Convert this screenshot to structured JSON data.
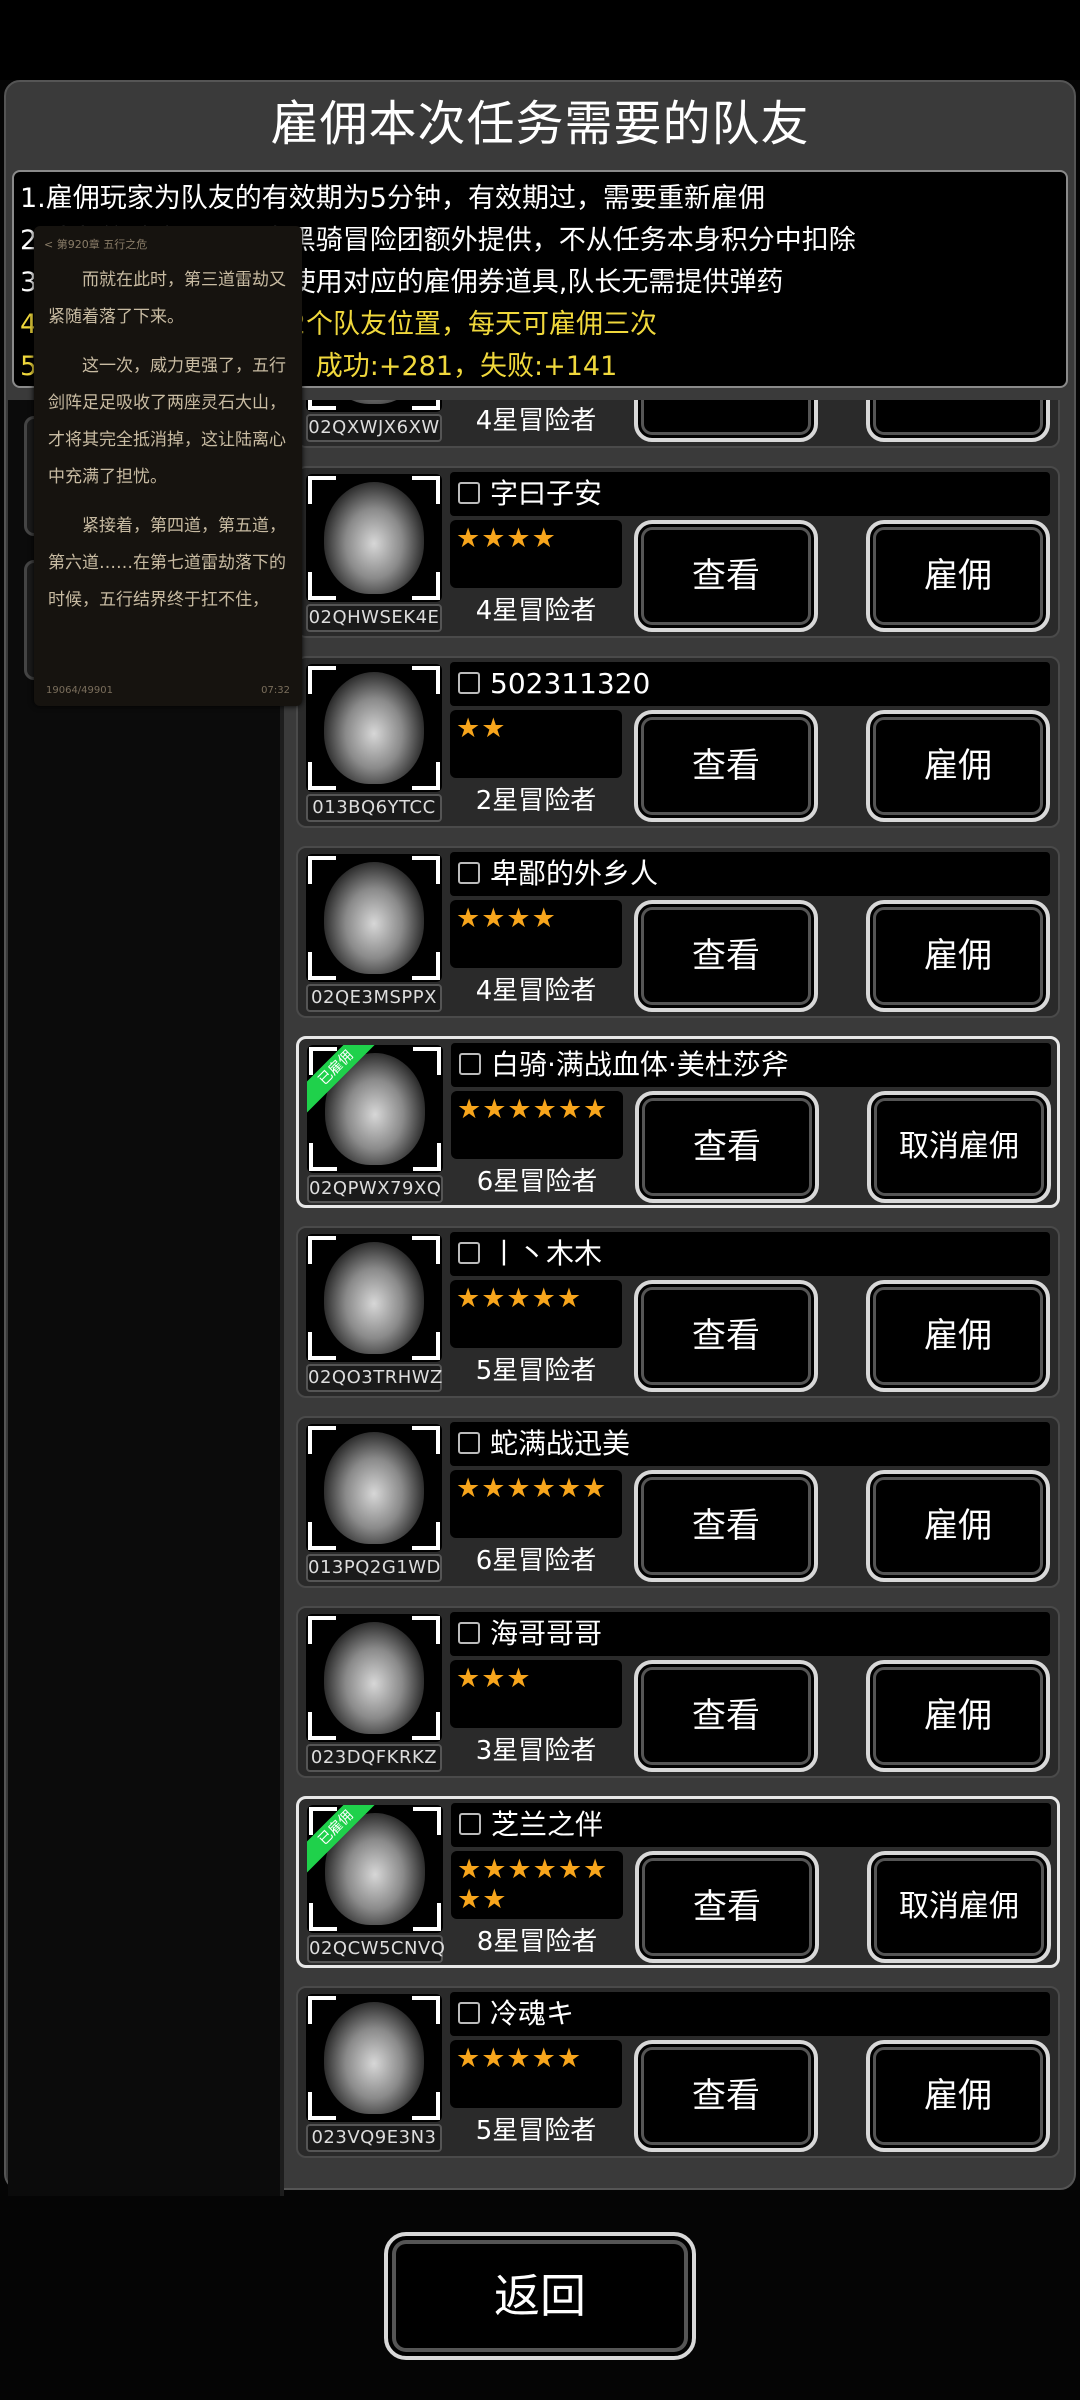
{
  "title": "雇佣本次任务需要的队友",
  "rules": [
    "1.雇佣玩家为队友的有效期为5分钟，有效期过，需要重新雇佣",
    "2.队友的被雇佣积分由黑骑冒险团额外提供，不从任务本身积分中扣除",
    "3.队长雇佣队友，需要使用对应的雇佣券道具,队长无需提供弹药",
    "4.每个队长最多可雇佣2个队友位置，每天可雇佣三次",
    "5.队友单次被雇佣积分，成功:+281，失败:+141"
  ],
  "view_label": "查看",
  "hire_label": "雇佣",
  "cancel_label": "取消雇佣",
  "hired_badge": "已雇佣",
  "back_label": "返回",
  "star_color": "#f7a51c",
  "players": [
    {
      "name": "",
      "uid": "02QXWJX6XW",
      "stars": "★★★★",
      "level": "4星冒险者",
      "hired": false
    },
    {
      "name": "字曰子安",
      "uid": "02QHWSEK4E",
      "stars": "★★★★",
      "level": "4星冒险者",
      "hired": false
    },
    {
      "name": "502311320",
      "uid": "013BQ6YTCC",
      "stars": "★★",
      "level": "2星冒险者",
      "hired": false
    },
    {
      "name": "卑鄙的外乡人",
      "uid": "02QE3MSPPX",
      "stars": "★★★★",
      "level": "4星冒险者",
      "hired": false
    },
    {
      "name": "白骑·满战血体·美杜莎斧",
      "uid": "02QPWX79XQ",
      "stars": "★★★★★★",
      "level": "6星冒险者",
      "hired": true
    },
    {
      "name": "丨丶木木",
      "uid": "02QO3TRHWZ",
      "stars": "★★★★★",
      "level": "5星冒险者",
      "hired": false
    },
    {
      "name": "蛇满战迅美",
      "uid": "013PQ2G1WD",
      "stars": "★★★★★★",
      "level": "6星冒险者",
      "hired": false
    },
    {
      "name": "海哥哥哥",
      "uid": "023DQFKRKZ",
      "stars": "★★★",
      "level": "3星冒险者",
      "hired": false
    },
    {
      "name": "芝兰之伴",
      "uid": "02QCW5CNVQ",
      "stars": "★★★★★★★★",
      "level": "8星冒险者",
      "hired": true
    },
    {
      "name": "冷魂キ",
      "uid": "023VQ9E3N3",
      "stars": "★★★★★",
      "level": "5星冒险者",
      "hired": false
    }
  ],
  "overlay": {
    "header": "< 第920章 五行之危",
    "paragraphs": [
      "而就在此时，第三道雷劫又紧随着落了下来。",
      "这一次，威力更强了，五行剑阵足足吸收了两座灵石大山，才将其完全抵消掉，这让陆离心中充满了担忧。",
      "紧接着，第四道，第五道，第六道……在第七道雷劫落下的时候，五行结界终于扛不住，"
    ],
    "progress": "19064/49901",
    "time": "07:32"
  }
}
